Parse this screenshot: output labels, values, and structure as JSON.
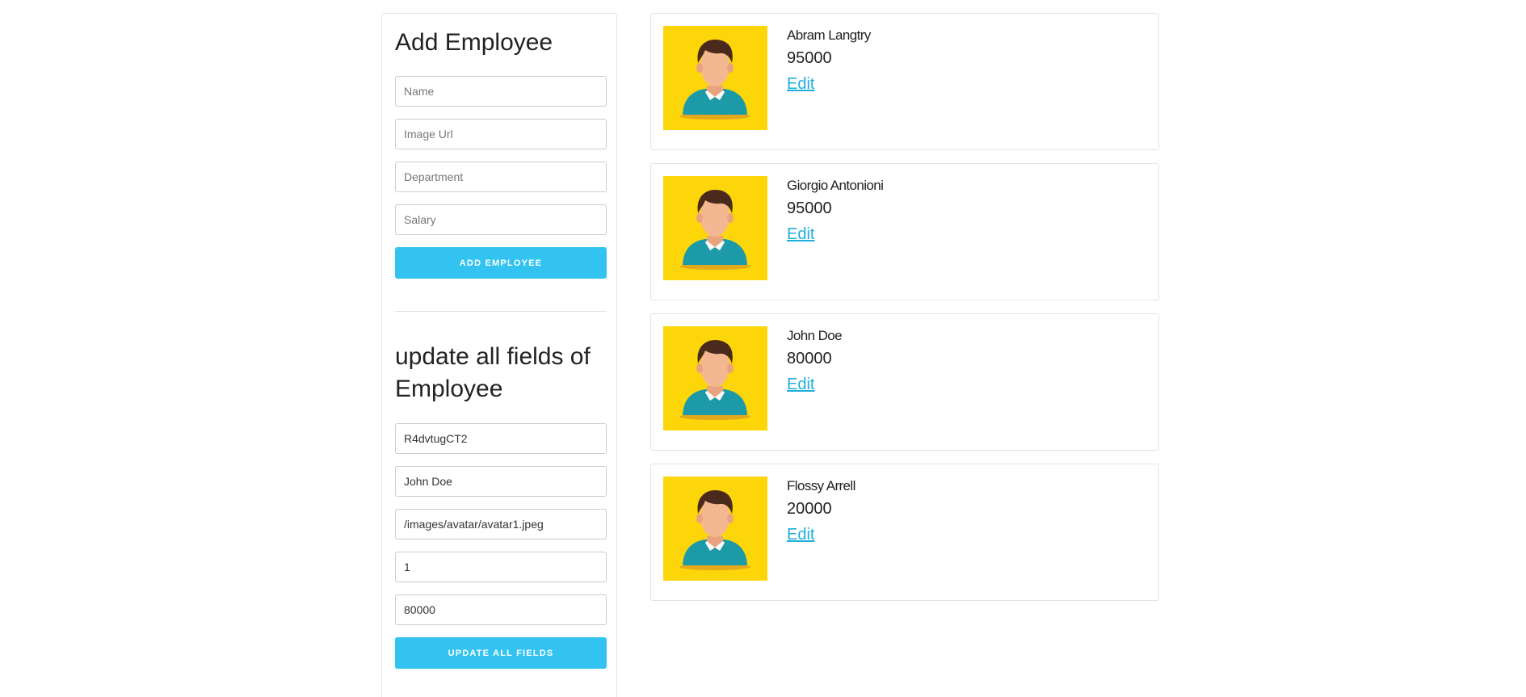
{
  "add_form": {
    "title": "Add Employee",
    "name_placeholder": "Name",
    "image_placeholder": "Image Url",
    "department_placeholder": "Department",
    "salary_placeholder": "Salary",
    "button_label": "Add Employee"
  },
  "update_form": {
    "title": "update all fields of Employee",
    "id_value": "R4dvtugCT2",
    "name_value": "John Doe",
    "image_value": "/images/avatar/avatar1.jpeg",
    "department_value": "1",
    "salary_value": "80000",
    "button_label": "Update All Fields"
  },
  "employees": [
    {
      "name": "Abram Langtry",
      "salary": "95000",
      "edit_label": "Edit"
    },
    {
      "name": "Giorgio Antonioni",
      "salary": "95000",
      "edit_label": "Edit"
    },
    {
      "name": "John Doe",
      "salary": "80000",
      "edit_label": "Edit"
    },
    {
      "name": "Flossy Arrell",
      "salary": "20000",
      "edit_label": "Edit"
    }
  ],
  "colors": {
    "accent": "#33c3f0",
    "link": "#1eaedb",
    "avatar_bg": "#fdd60a"
  }
}
